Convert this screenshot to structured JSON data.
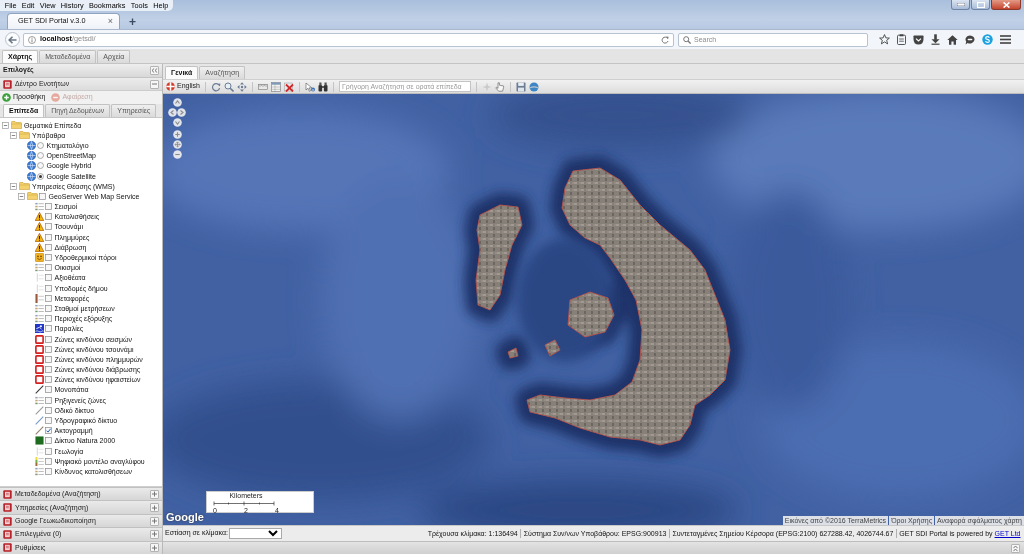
{
  "browser": {
    "menu": [
      "File",
      "Edit",
      "View",
      "History",
      "Bookmarks",
      "Tools",
      "Help"
    ],
    "tabs": [
      {
        "title": "GET SDI Portal v.3.0",
        "close": "×",
        "selected": true
      }
    ],
    "new_tab": "+",
    "url": "**localhost**/getsdi/",
    "search": {
      "placeholder": "Search"
    }
  },
  "app_tabs": [
    {
      "label": "Χάρτης",
      "selected": true
    },
    {
      "label": "Μεταδεδομένα",
      "selected": false
    },
    {
      "label": "Αρχεία",
      "selected": false
    }
  ],
  "sidebar": {
    "title": "Επιλογές",
    "tree_panel": {
      "title": "Δέντρο Ενοτήτων",
      "expanded": true
    },
    "actions": [
      {
        "label": "Προσθήκη",
        "kind": "add",
        "disabled": false
      },
      {
        "label": "Αφαίρεση",
        "kind": "remove",
        "disabled": true
      }
    ],
    "tabs": [
      {
        "label": "Επίπεδα",
        "selected": true
      },
      {
        "label": "Πηγή Δεδομένων",
        "selected": false
      },
      {
        "label": "Υπηρεσίες",
        "selected": false
      }
    ],
    "tree": [
      {
        "label": "Θεματικά Επίπεδα",
        "kind": "folder",
        "expanded": true,
        "children": [
          {
            "label": "Υπόβαθρα",
            "kind": "folder",
            "expanded": true,
            "children": [
              {
                "label": "Κτηματολόγιο",
                "kind": "base",
                "selected": false
              },
              {
                "label": "OpenStreetMap",
                "kind": "base",
                "selected": false
              },
              {
                "label": "Google Hybrid",
                "kind": "base",
                "selected": false
              },
              {
                "label": "Google Satellite",
                "kind": "base",
                "selected": true
              }
            ]
          },
          {
            "label": "Υπηρεσίες Θέασης (WMS)",
            "kind": "folder",
            "expanded": true,
            "children": [
              {
                "label": "GeoServer Web Map Service",
                "kind": "folder",
                "expanded": true,
                "checked": false,
                "children": [
                  {
                    "label": "Σεισμοί",
                    "kind": "list",
                    "checked": false
                  },
                  {
                    "label": "Κατολισθήσεις",
                    "kind": "warning",
                    "checked": false
                  },
                  {
                    "label": "Τσουνάμι",
                    "kind": "warning",
                    "checked": false
                  },
                  {
                    "label": "Πλημμύρες",
                    "kind": "warning",
                    "checked": false
                  },
                  {
                    "label": "Διάβρωση",
                    "kind": "warning",
                    "checked": false
                  },
                  {
                    "label": "Υδροθερμικοί πόροι",
                    "kind": "smiley",
                    "checked": false
                  },
                  {
                    "label": "Οικισμοί",
                    "kind": "list",
                    "checked": false
                  },
                  {
                    "label": "Αξιοθέατα",
                    "kind": "faint",
                    "checked": false
                  },
                  {
                    "label": "Υποδομές δήμου",
                    "kind": "faint",
                    "checked": false
                  },
                  {
                    "label": "Μεταφορές",
                    "kind": "bar",
                    "checked": false
                  },
                  {
                    "label": "Σταθμοί μετρήσεων",
                    "kind": "list",
                    "checked": false
                  },
                  {
                    "label": "Περιοχές εξόρυξης",
                    "kind": "list",
                    "checked": false
                  },
                  {
                    "label": "Παραλίες",
                    "kind": "beach",
                    "checked": false
                  },
                  {
                    "label": "Ζώνες κινδύνου σεισμών",
                    "kind": "zone",
                    "checked": false
                  },
                  {
                    "label": "Ζώνες κινδύνου τσουνάμι",
                    "kind": "zone",
                    "checked": false
                  },
                  {
                    "label": "Ζώνες κινδύνου πλημμυρών",
                    "kind": "zone",
                    "checked": false
                  },
                  {
                    "label": "Ζώνες κινδύνου διάβρωσης",
                    "kind": "zone",
                    "checked": false
                  },
                  {
                    "label": "Ζώνες κινδύνου ηφαιστείων",
                    "kind": "zone",
                    "checked": false
                  },
                  {
                    "label": "Μονοπάτια",
                    "kind": "line",
                    "color": "#3a3a3a",
                    "checked": false
                  },
                  {
                    "label": "Ρηξιγενείς ζώνες",
                    "kind": "list",
                    "checked": false
                  },
                  {
                    "label": "Οδικό δίκτυο",
                    "kind": "line",
                    "color": "#9a9a9a",
                    "checked": false
                  },
                  {
                    "label": "Υδρογραφικό δίκτυο",
                    "kind": "line",
                    "color": "#7a9ac8",
                    "checked": false
                  },
                  {
                    "label": "Ακτογραμμή",
                    "kind": "line",
                    "color": "#9a8070",
                    "checked": true
                  },
                  {
                    "label": "Δίκτυο Natura 2000",
                    "kind": "area",
                    "color": "#1e6a1e",
                    "checked": false
                  },
                  {
                    "label": "Γεωλογία",
                    "kind": "faint",
                    "checked": false
                  },
                  {
                    "label": "Ψηφιακό μοντέλο αναγλύφου",
                    "kind": "ramp",
                    "checked": false
                  },
                  {
                    "label": "Κίνδυνος κατολισθήσεων",
                    "kind": "list",
                    "checked": false
                  }
                ]
              }
            ]
          }
        ]
      }
    ],
    "panels": [
      {
        "title": "Μεταδεδομένα (Αναζήτηση)",
        "expanded": false
      },
      {
        "title": "Υπηρεσίες (Αναζήτηση)",
        "expanded": false
      },
      {
        "title": "Google Γεωκωδικοποίηση",
        "expanded": false
      },
      {
        "title": "Επιλεγμένα (0)",
        "expanded": false
      },
      {
        "title": "Ρυθμίσεις",
        "expanded": false
      }
    ]
  },
  "map_tabs": [
    {
      "label": "Γενικά",
      "selected": true
    },
    {
      "label": "Αναζήτηση",
      "selected": false
    }
  ],
  "toolbar": {
    "language": "English",
    "quick_search": {
      "placeholder": "Γρήγορη Αναζήτηση σε ορατά επίπεδα"
    }
  },
  "map": {
    "logo": "Google",
    "scale": {
      "title": "Kilometers",
      "ticks": [
        "0",
        "2",
        "4"
      ]
    },
    "attribution": [
      "Εικόνες από ©2016 TerraMetrics",
      "Όροι Χρήσης",
      "Αναφορά σφάλματος χάρτη"
    ]
  },
  "status_bar": {
    "zoom_label": "Εστίαση σε κλίμακα:",
    "items": [
      "Τρέχουσα κλίμακα: 1:136494",
      "Σύστημα Συν/νων Υποβάθρου: EPSG:900913",
      "Συντεταγμένες Σημείου Κέρσορα (EPSG:2100) 627288.42, 4026744.67"
    ],
    "credit": "GET SDI Portal is powered by",
    "credit_link": "GET Ltd"
  }
}
